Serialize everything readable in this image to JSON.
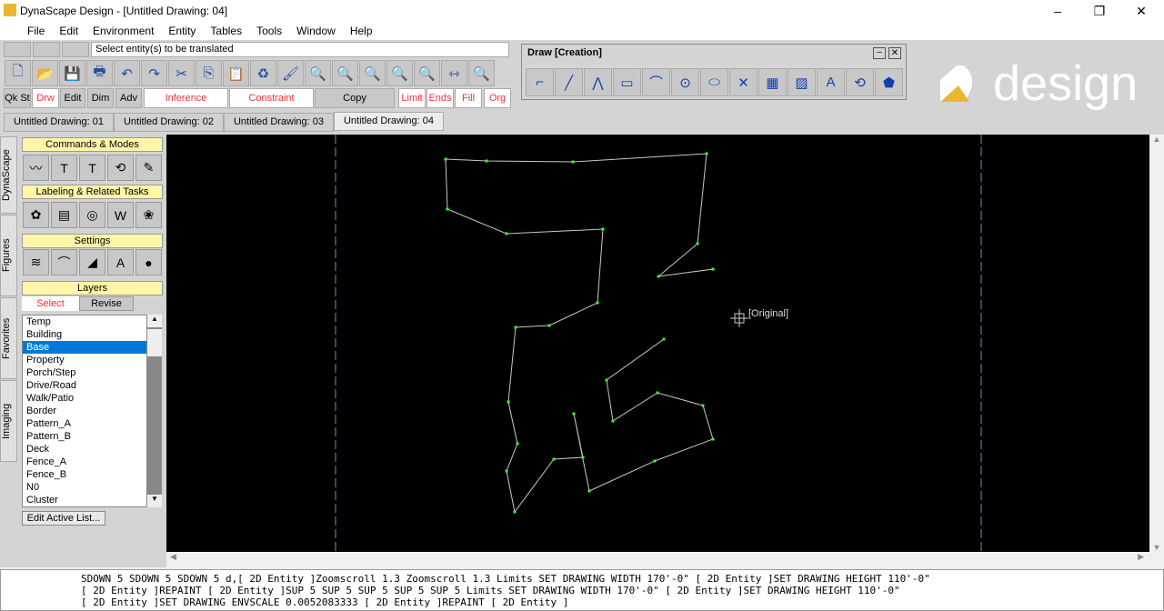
{
  "window": {
    "title": "DynaScape Design  - [Untitled Drawing: 04]"
  },
  "menu": [
    "File",
    "Edit",
    "Environment",
    "Entity",
    "Tables",
    "Tools",
    "Window",
    "Help"
  ],
  "status_prompt": "Select entity(s) to be translated",
  "mode_buttons": [
    {
      "label": "Qk St",
      "hl": false
    },
    {
      "label": "Drw",
      "hl": true
    },
    {
      "label": "Edit",
      "hl": false
    },
    {
      "label": "Dim",
      "hl": false
    },
    {
      "label": "Adv",
      "hl": false
    },
    {
      "label": "Inference",
      "hl": true
    },
    {
      "label": "Constraint",
      "hl": true
    },
    {
      "label": "Copy",
      "hl": false
    },
    {
      "label": "Limit",
      "hl": true
    },
    {
      "label": "Ends",
      "hl": true
    },
    {
      "label": "Fill",
      "hl": true
    },
    {
      "label": "Org",
      "hl": true
    }
  ],
  "drawing_tabs": [
    "Untitled Drawing: 01",
    "Untitled Drawing: 02",
    "Untitled Drawing: 03",
    "Untitled Drawing: 04"
  ],
  "draw_palette": {
    "title": "Draw [Creation]"
  },
  "logo": {
    "text": "design"
  },
  "side_tabs": [
    "DynaScape",
    "Figures",
    "Favorites",
    "Imaging"
  ],
  "panel": {
    "commands": "Commands & Modes",
    "labeling": "Labeling & Related Tasks",
    "settings": "Settings",
    "layers": "Layers",
    "select": "Select",
    "revise": "Revise",
    "edit_list": "Edit Active List..."
  },
  "layers": [
    "Temp",
    "Building",
    "Base",
    "Property",
    "Porch/Step",
    "Drive/Road",
    "Walk/Patio",
    "Border",
    "Pattern_A",
    "Pattern_B",
    "Deck",
    "Fence_A",
    "Fence_B",
    "N0",
    "Cluster"
  ],
  "selected_layer": "Base",
  "canvas": {
    "origin_label": "[Original]"
  },
  "command_log": [
    "SDOWN 5 SDOWN 5 SDOWN 5 d,[ 2D Entity ]Zoomscroll 1.3 Zoomscroll 1.3 Limits SET DRAWING WIDTH 170'-0\" [ 2D Entity ]SET DRAWING HEIGHT 110'-0\"",
    "[ 2D Entity ]REPAINT [ 2D Entity ]SUP 5 SUP 5 SUP 5 SUP 5 SUP 5 Limits SET DRAWING WIDTH 170'-0\" [ 2D Entity ]SET DRAWING HEIGHT 110'-0\"",
    "[ 2D Entity ]SET DRAWING ENVSCALE 0.0052083333 [ 2D Entity ]REPAINT [ 2D Entity ]"
  ]
}
